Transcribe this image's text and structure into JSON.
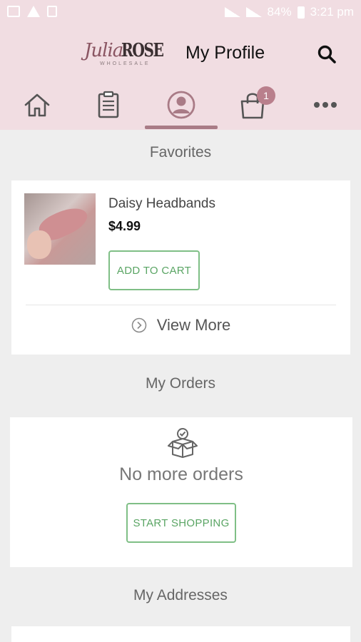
{
  "status_bar": {
    "battery": "84%",
    "time": "3:21 pm"
  },
  "header": {
    "logo_script": "Julia",
    "logo_bold": "ROSE",
    "logo_sub": "WHOLESALE",
    "title": "My Profile"
  },
  "nav": {
    "items": [
      {
        "name": "home",
        "icon": "home-icon"
      },
      {
        "name": "orders",
        "icon": "clipboard-icon"
      },
      {
        "name": "profile",
        "icon": "user-circle-icon",
        "active": true
      },
      {
        "name": "cart",
        "icon": "shopping-bag-icon",
        "badge": "1"
      },
      {
        "name": "more",
        "icon": "more-dots-icon"
      }
    ],
    "cart_badge": "1",
    "accent_color": "#a97b86"
  },
  "favorites": {
    "title": "Favorites",
    "product": {
      "name": "Daisy Headbands",
      "price": "$4.99",
      "button": "ADD TO CART"
    },
    "view_more": "View More"
  },
  "orders": {
    "title": "My Orders",
    "empty_text": "No more orders",
    "button": "START SHOPPING"
  },
  "addresses": {
    "title": "My Addresses"
  },
  "colors": {
    "header_bg": "#f1dde2",
    "button_green": "#5aa564"
  }
}
